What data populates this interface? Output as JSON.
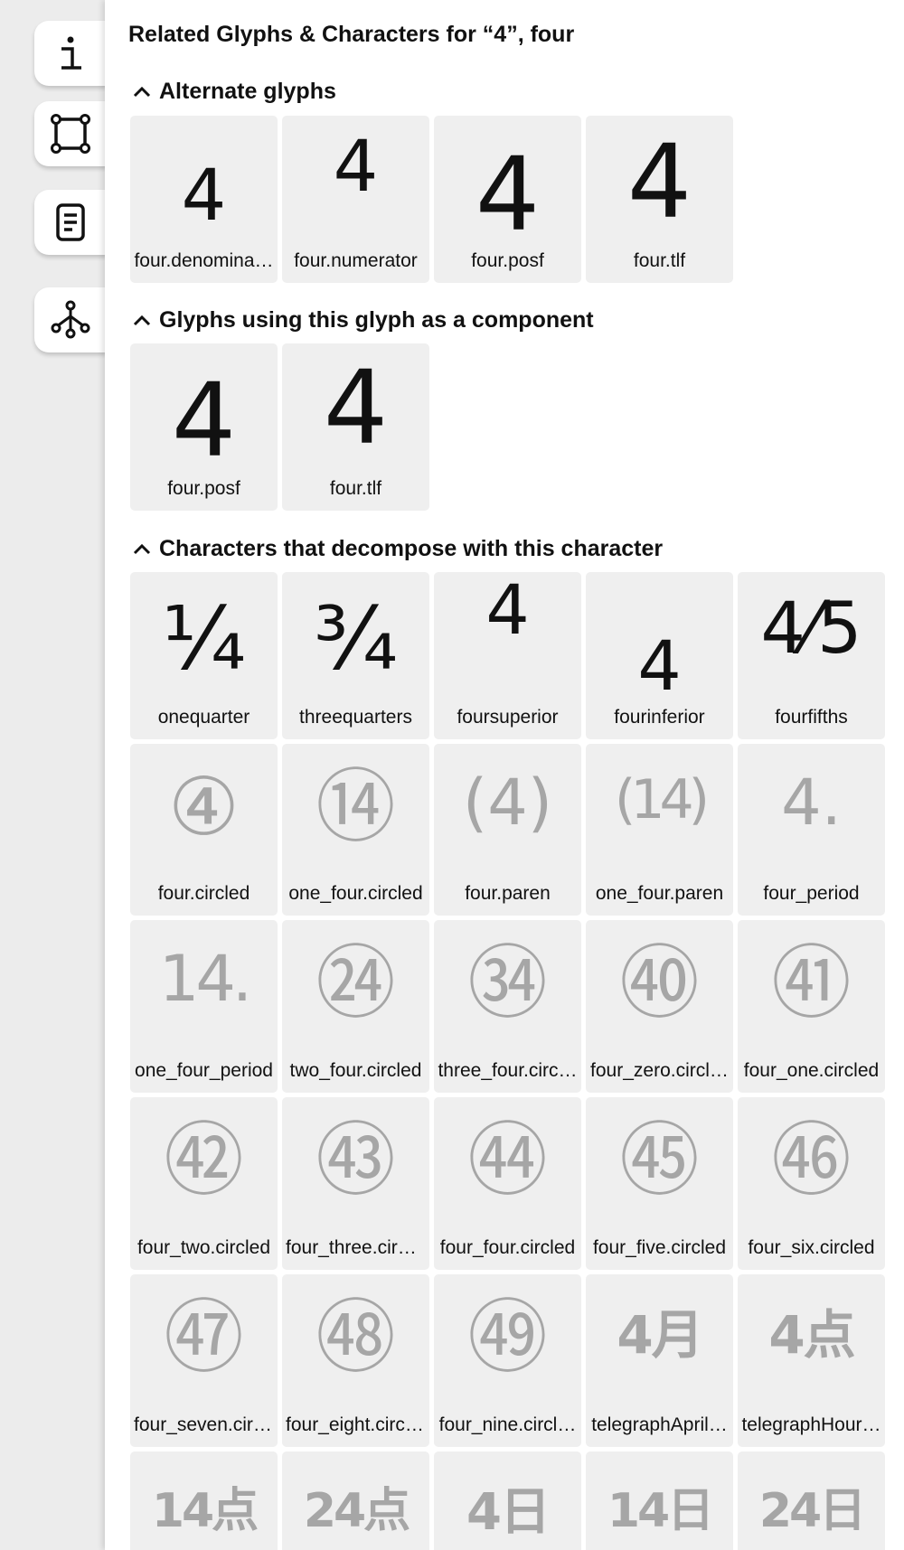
{
  "rail": {
    "tabs": [
      {
        "icon": "info-icon",
        "label": "i"
      },
      {
        "icon": "bounding-box-icon"
      },
      {
        "icon": "document-icon"
      },
      {
        "icon": "relations-icon"
      }
    ]
  },
  "panel": {
    "title": "Related Glyphs & Characters for “4”, four",
    "sections": [
      {
        "header": "Alternate glyphs",
        "items": [
          {
            "glyph": "4",
            "name": "four.denomina…"
          },
          {
            "glyph": "4",
            "name": "four.numerator"
          },
          {
            "glyph": "4",
            "name": "four.posf"
          },
          {
            "glyph": "4",
            "name": "four.tlf"
          }
        ]
      },
      {
        "header": "Glyphs using this glyph as a component",
        "items": [
          {
            "glyph": "4",
            "name": "four.posf"
          },
          {
            "glyph": "4",
            "name": "four.tlf"
          }
        ]
      },
      {
        "header": "Characters that decompose with this character",
        "items": [
          {
            "glyph": "¼",
            "name": "onequarter"
          },
          {
            "glyph": "¾",
            "name": "threequarters"
          },
          {
            "glyph": "4",
            "name": "foursuperior"
          },
          {
            "glyph": "4",
            "name": "fourinferior"
          },
          {
            "glyph": "4⁄5",
            "name": "fourfifths"
          },
          {
            "glyph": "④",
            "name": "four.circled"
          },
          {
            "glyph": "⑭",
            "name": "one_four.circled"
          },
          {
            "glyph": "(4)",
            "name": "four.paren"
          },
          {
            "glyph": "(14)",
            "name": "one_four.paren"
          },
          {
            "glyph": "4.",
            "name": "four_period"
          },
          {
            "glyph": "14.",
            "name": "one_four_period"
          },
          {
            "glyph": "㉔",
            "name": "two_four.circled"
          },
          {
            "glyph": "㉞",
            "name": "three_four.circ…"
          },
          {
            "glyph": "㊵",
            "name": "four_zero.circl…"
          },
          {
            "glyph": "㊶",
            "name": "four_one.circled"
          },
          {
            "glyph": "㊷",
            "name": "four_two.circled"
          },
          {
            "glyph": "㊸",
            "name": "four_three.circ…"
          },
          {
            "glyph": "㊹",
            "name": "four_four.circled"
          },
          {
            "glyph": "㊺",
            "name": "four_five.circled"
          },
          {
            "glyph": "㊻",
            "name": "four_six.circled"
          },
          {
            "glyph": "㊼",
            "name": "four_seven.circ…"
          },
          {
            "glyph": "㊽",
            "name": "four_eight.circl…"
          },
          {
            "glyph": "㊾",
            "name": "four_nine.circl…"
          },
          {
            "glyph": "4月",
            "name": "telegraphApril…"
          },
          {
            "glyph": "4点",
            "name": "telegraphHour…"
          },
          {
            "glyph": "14点",
            "name": ""
          },
          {
            "glyph": "24点",
            "name": ""
          },
          {
            "glyph": "4日",
            "name": ""
          },
          {
            "glyph": "14日",
            "name": ""
          },
          {
            "glyph": "24日",
            "name": ""
          }
        ]
      }
    ]
  },
  "colors": {
    "panel_bg": "#ffffff",
    "card_bg": "#efefef",
    "grey_glyph": "#a6a6a6",
    "rail_bg": "#ececec"
  }
}
